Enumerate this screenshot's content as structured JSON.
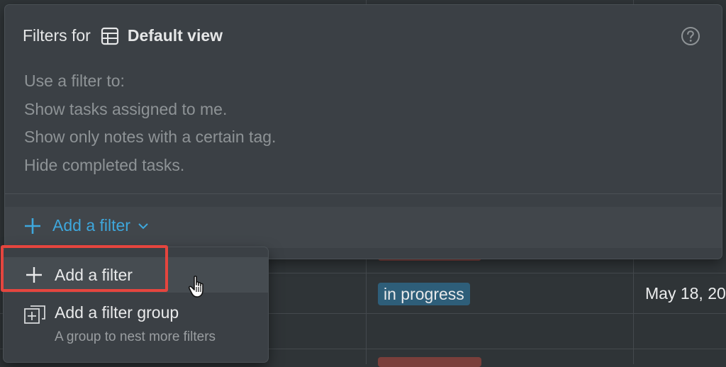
{
  "panel": {
    "title_prefix": "Filters for",
    "view_name": "Default view",
    "view_icon": "table-icon",
    "help_icon": "help-circle-icon",
    "hint_lines": [
      "Use a filter to:",
      "Show tasks assigned to me.",
      "Show only notes with a certain tag.",
      "Hide completed tasks."
    ],
    "add_filter_label": "Add a filter",
    "accent": "#3ea7dc"
  },
  "menu": {
    "add_filter": {
      "label": "Add a filter",
      "icon": "plus-icon"
    },
    "add_group": {
      "label": "Add a filter group",
      "description": "A group to nest more filters",
      "icon": "filter-group-icon"
    },
    "highlight_color": "#e5453e"
  },
  "background": {
    "status_tag": "in progress",
    "status_tag_color": "#2e5e79",
    "date": "May 18, 20"
  }
}
